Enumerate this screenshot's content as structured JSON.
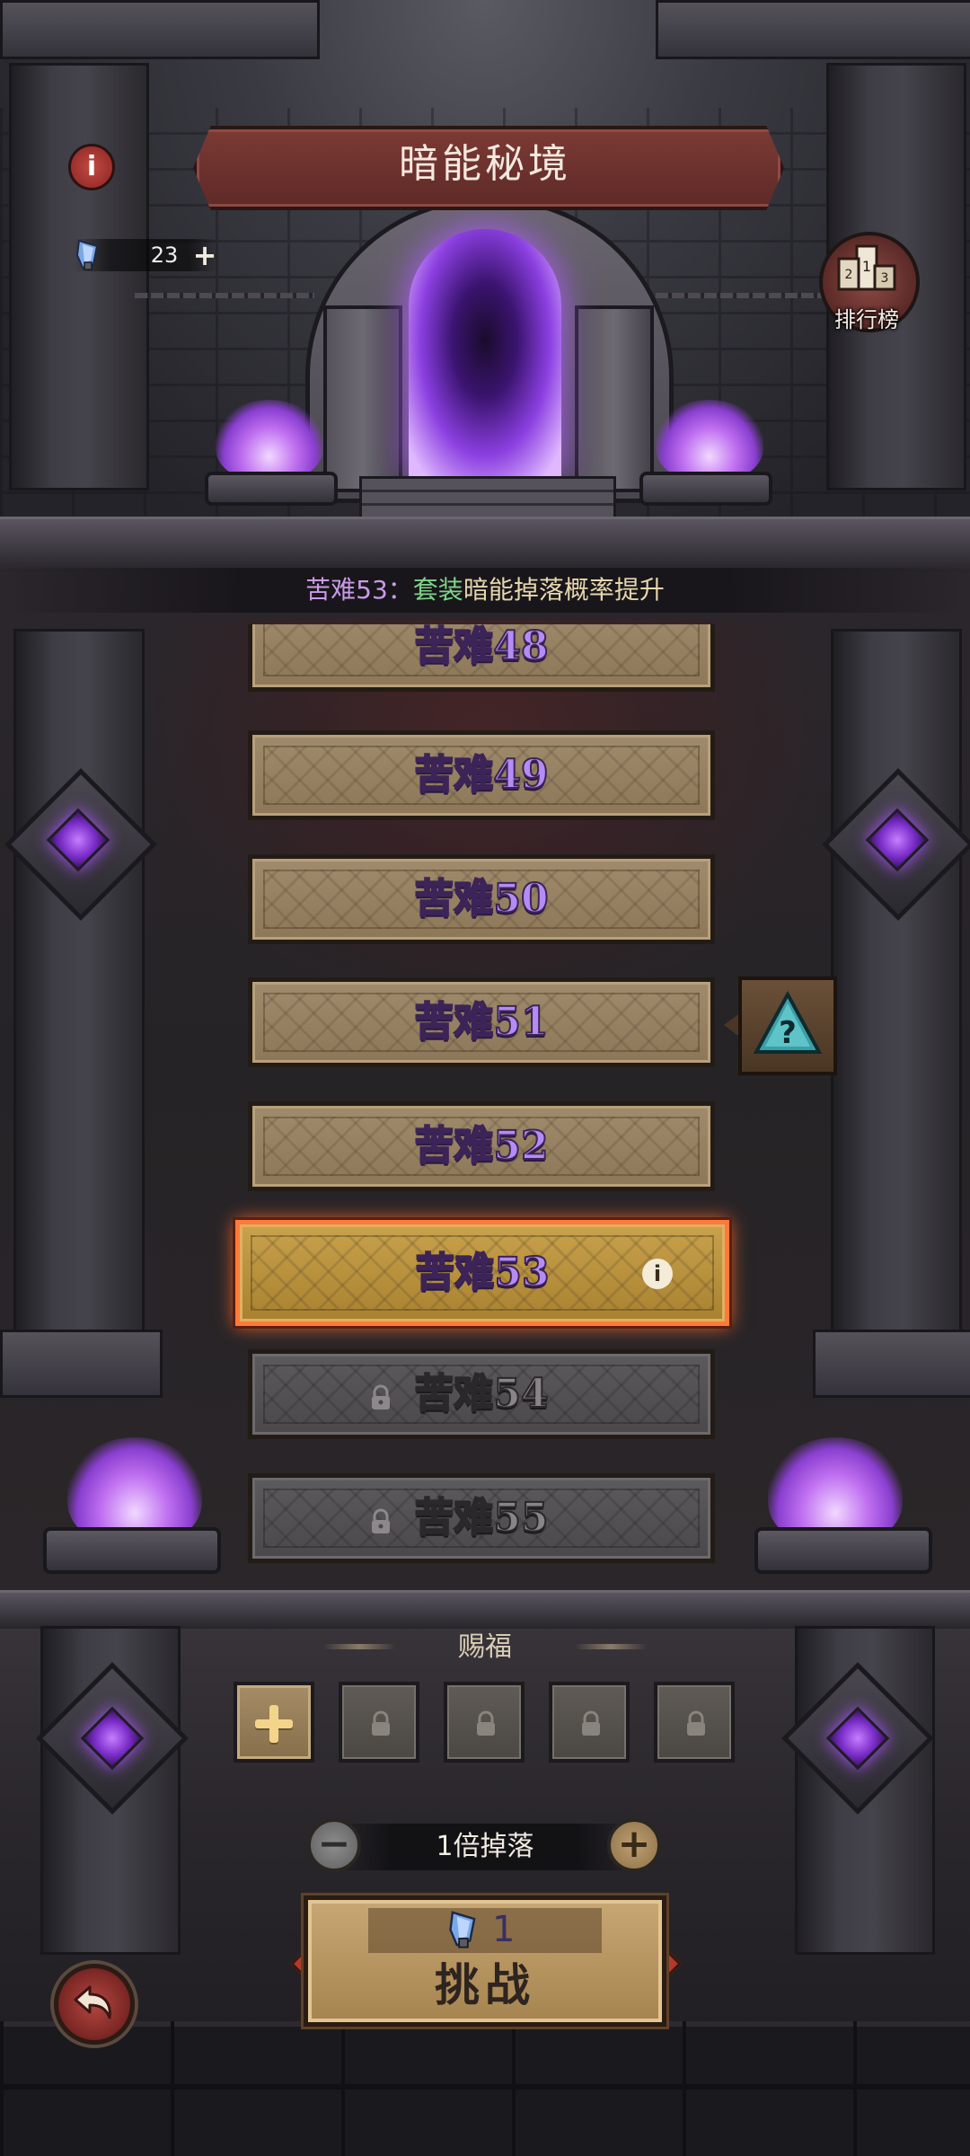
{
  "header": {
    "title": "暗能秘境",
    "info_icon": "info-icon",
    "currency": {
      "icon": "crystal-key-icon",
      "value": "23",
      "add_symbol": "+"
    },
    "ranking_label": "排行榜"
  },
  "tip": {
    "prefix": "苦难53：",
    "highlight": "套装",
    "suffix": "暗能掉落概率提升"
  },
  "levels": [
    {
      "label": "苦难48",
      "state": "unlocked"
    },
    {
      "label": "苦难49",
      "state": "unlocked"
    },
    {
      "label": "苦难50",
      "state": "unlocked"
    },
    {
      "label": "苦难51",
      "state": "unlocked"
    },
    {
      "label": "苦难52",
      "state": "unlocked"
    },
    {
      "label": "苦难53",
      "state": "selected"
    },
    {
      "label": "苦难54",
      "state": "locked"
    },
    {
      "label": "苦难55",
      "state": "locked"
    }
  ],
  "mystery_icon": "question-triangle-icon",
  "blessing": {
    "title": "赐福",
    "slots": [
      "add",
      "locked",
      "locked",
      "locked",
      "locked"
    ]
  },
  "multiplier": {
    "label": "1倍掉落",
    "minus": "−",
    "plus": "+"
  },
  "challenge": {
    "cost": "1",
    "label": "挑战"
  },
  "colors": {
    "level_text": "#b58cf5",
    "selected_border": "#ff7a3a",
    "tip_highlight": "#7ed38a",
    "portal_glow": "#b05cff"
  }
}
